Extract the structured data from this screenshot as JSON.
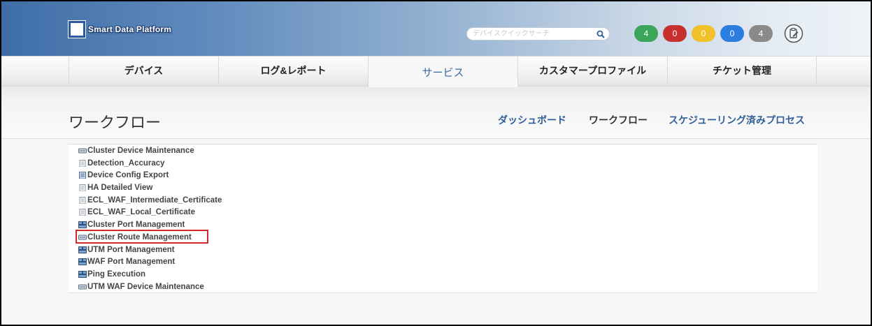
{
  "header": {
    "logo_text": "Smart Data Platform",
    "search_placeholder": "デバイスクイックサーチ",
    "badges": [
      {
        "value": "4",
        "color": "#3aa65b"
      },
      {
        "value": "0",
        "color": "#c8302f"
      },
      {
        "value": "0",
        "color": "#f2c12a"
      },
      {
        "value": "0",
        "color": "#2b7de0"
      },
      {
        "value": "4",
        "color": "#8a8a8a"
      }
    ]
  },
  "nav": {
    "tabs": [
      {
        "label": "デバイス"
      },
      {
        "label": "ログ&レポート"
      },
      {
        "label": "サービス",
        "active": true
      },
      {
        "label": "カスタマープロファイル"
      },
      {
        "label": "チケット管理"
      }
    ]
  },
  "subheader": {
    "title": "ワークフロー",
    "links": [
      {
        "label": "ダッシュボード",
        "color": "#2f5f98"
      },
      {
        "label": "ワークフロー",
        "color": "#333333",
        "current": true
      },
      {
        "label": "スケジューリング済みプロセス",
        "color": "#2f5f98"
      }
    ]
  },
  "workflows": [
    {
      "label": "Cluster Device Maintenance",
      "icon": "device-icon"
    },
    {
      "label": "Detection_Accuracy",
      "icon": "document-icon"
    },
    {
      "label": "Device Config Export",
      "icon": "config-file-icon"
    },
    {
      "label": "HA Detailed View",
      "icon": "document-icon"
    },
    {
      "label": "ECL_WAF_Intermediate_Certificate",
      "icon": "document-icon"
    },
    {
      "label": "ECL_WAF_Local_Certificate",
      "icon": "document-icon"
    },
    {
      "label": "Cluster Port Management",
      "icon": "network-icon"
    },
    {
      "label": "Cluster Route Management",
      "icon": "device-icon",
      "highlighted": true
    },
    {
      "label": "UTM Port Management",
      "icon": "network-icon"
    },
    {
      "label": "WAF Port Management",
      "icon": "network-icon"
    },
    {
      "label": "Ping Execution",
      "icon": "network-icon"
    },
    {
      "label": "UTM WAF Device Maintenance",
      "icon": "device-icon"
    }
  ],
  "colors": {
    "accent": "#3c6ba5",
    "highlight_border": "#d62828"
  }
}
